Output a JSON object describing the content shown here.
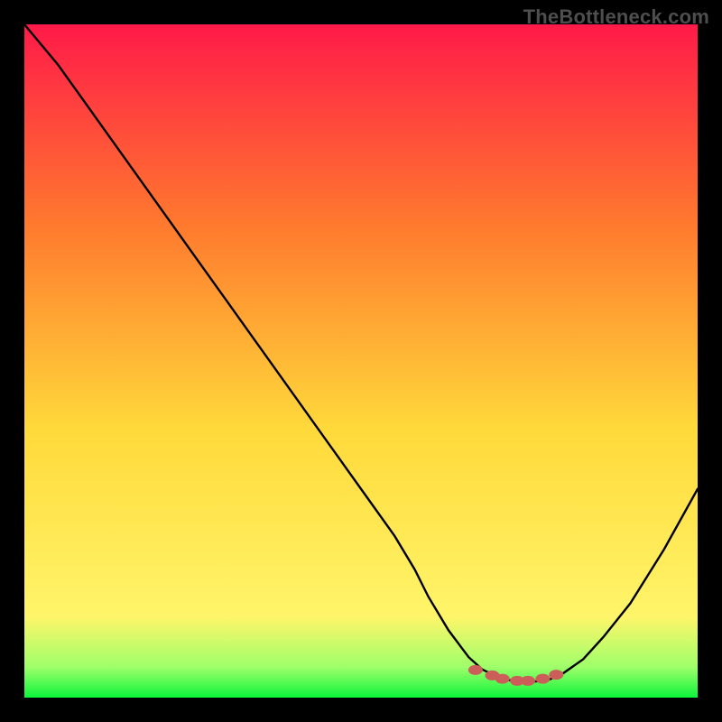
{
  "watermark": "TheBottleneck.com",
  "colors": {
    "bg_black": "#000000",
    "grad_top": "#ff1a49",
    "grad_mid_upper": "#ff7a2e",
    "grad_mid": "#ffd93a",
    "grad_low": "#fff56a",
    "grad_green_light": "#9eff6a",
    "grad_green": "#0cf53c",
    "curve": "#000000",
    "dots": "#cc5e5a",
    "watermark": "#4e4e4e"
  },
  "chart_data": {
    "type": "line",
    "title": "",
    "xlabel": "",
    "ylabel": "",
    "xlim": [
      0,
      100
    ],
    "ylim": [
      0,
      100
    ],
    "series": [
      {
        "name": "bottleneck-curve",
        "x": [
          0,
          5,
          10,
          15,
          20,
          25,
          30,
          35,
          40,
          45,
          50,
          55,
          58,
          60,
          63,
          66,
          68,
          70,
          72,
          74,
          76,
          78,
          80,
          83,
          86,
          90,
          95,
          100
        ],
        "y": [
          100,
          94,
          87,
          80,
          73,
          66,
          59,
          52,
          45,
          38,
          31,
          24,
          19,
          15,
          10,
          6,
          4.2,
          3.2,
          2.6,
          2.4,
          2.4,
          2.7,
          3.6,
          5.7,
          9,
          14,
          22,
          31
        ]
      }
    ],
    "dots": {
      "name": "bottom-cluster",
      "x": [
        67,
        69.5,
        71,
        73.2,
        74.8,
        77,
        79
      ],
      "y": [
        4.1,
        3.3,
        2.8,
        2.5,
        2.5,
        2.8,
        3.4
      ]
    }
  }
}
